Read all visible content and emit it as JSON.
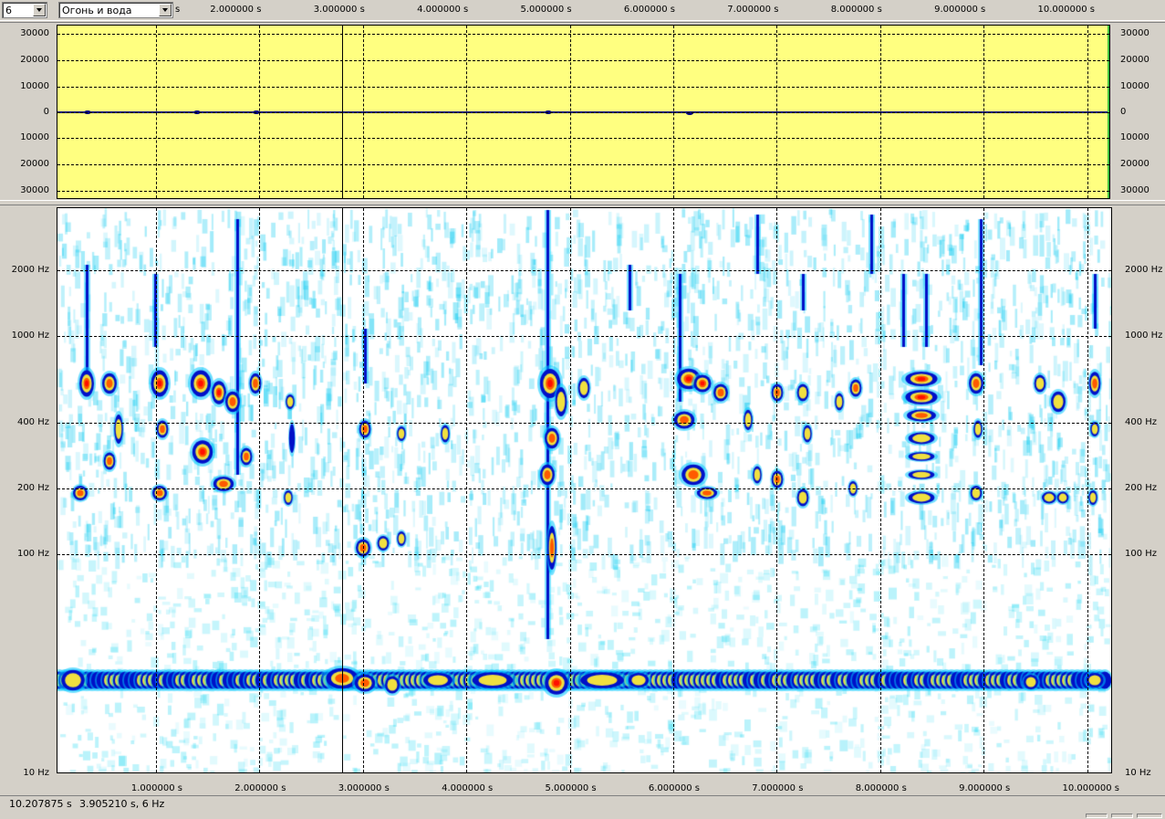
{
  "toolbar": {
    "zoom_value": "6",
    "file_name": "Огонь и вода",
    "unit_suffix": "s"
  },
  "time_axis": {
    "top_labels": [
      "2.000000 s",
      "3.000000 s",
      "4.000000 s",
      "5.000000 s",
      "6.000000 s",
      "7.000000 s",
      "8.000000 s",
      "9.000000 s",
      "10.000000 s"
    ],
    "bottom_labels": [
      "1.000000 s",
      "2.000000 s",
      "3.000000 s",
      "4.000000 s",
      "5.000000 s",
      "6.000000 s",
      "7.000000 s",
      "8.000000 s",
      "9.000000 s",
      "10.000000 s"
    ]
  },
  "waveform": {
    "y_labels": [
      "30000",
      "20000",
      "10000",
      "0",
      "10000",
      "20000",
      "30000"
    ],
    "background_color": "#ffff80",
    "line_color": "#000080"
  },
  "spectrogram": {
    "y_labels": [
      "2000 Hz",
      "1000 Hz",
      "400 Hz",
      "200 Hz",
      "100 Hz",
      "10 Hz"
    ]
  },
  "status_bar": {
    "duration": "10.207875 s",
    "cursor_position": "3.905210 s, 6 Hz"
  },
  "colors": {
    "panel": "#d4d0c8",
    "spectrogram_low": "#ffffff",
    "spectrogram_mid": "#00c0ff",
    "spectrogram_high": "#ff2000"
  }
}
